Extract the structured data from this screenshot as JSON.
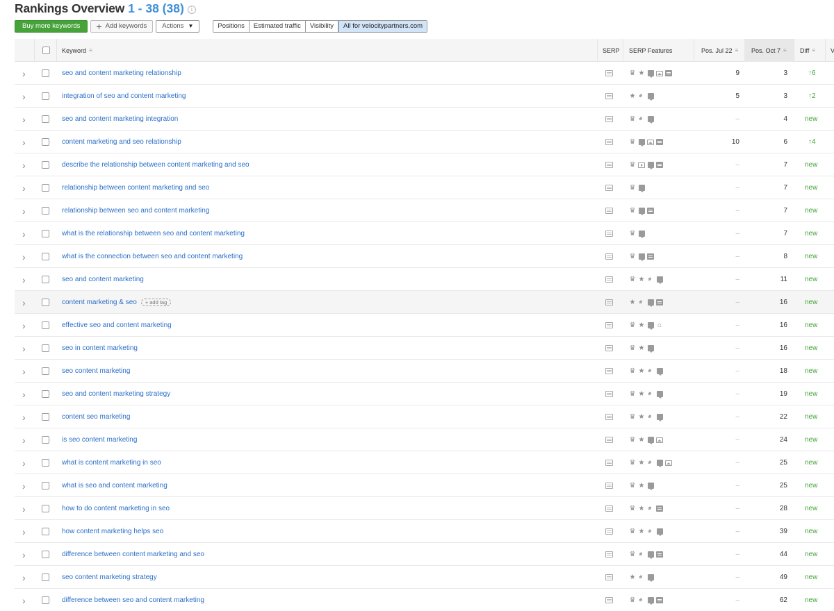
{
  "header": {
    "title": "Rankings Overview",
    "count": "1 - 38 (38)",
    "info_glyph": "i"
  },
  "toolbar": {
    "buy_label": "Buy more keywords",
    "add_label": "Add keywords",
    "actions_label": "Actions",
    "segments": [
      "Positions",
      "Estimated traffic",
      "Visibility",
      "All for velocitypartners.com"
    ],
    "active_segment": "All for velocitypartners.com"
  },
  "table": {
    "columns": {
      "keyword": "Keyword",
      "serp": "SERP",
      "serp_features": "SERP Features",
      "pos1": "Pos. Jul 22",
      "pos2": "Pos. Oct 7",
      "diff": "Diff",
      "volume_partial": "V"
    },
    "add_tag_label": "add tag",
    "rows": [
      {
        "keyword": "seo and content marketing relationship",
        "features": [
          "crown",
          "star",
          "box",
          "img",
          "news"
        ],
        "pos1": "9",
        "pos2": "3",
        "diff": "6",
        "diff_type": "up"
      },
      {
        "keyword": "integration of seo and content marketing",
        "features": [
          "star",
          "link",
          "box"
        ],
        "pos1": "5",
        "pos2": "3",
        "diff": "2",
        "diff_type": "up"
      },
      {
        "keyword": "seo and content marketing integration",
        "features": [
          "crown",
          "link",
          "box"
        ],
        "pos1": "–",
        "pos2": "4",
        "diff": "new",
        "diff_type": "new"
      },
      {
        "keyword": "content marketing and seo relationship",
        "features": [
          "crown",
          "box",
          "img",
          "news"
        ],
        "pos1": "10",
        "pos2": "6",
        "diff": "4",
        "diff_type": "up"
      },
      {
        "keyword": "describe the relationship between content marketing and seo",
        "features": [
          "crown",
          "video",
          "box",
          "news"
        ],
        "pos1": "–",
        "pos2": "7",
        "diff": "new",
        "diff_type": "new"
      },
      {
        "keyword": "relationship between content marketing and seo",
        "features": [
          "crown",
          "box"
        ],
        "pos1": "–",
        "pos2": "7",
        "diff": "new",
        "diff_type": "new"
      },
      {
        "keyword": "relationship between seo and content marketing",
        "features": [
          "crown",
          "box",
          "news"
        ],
        "pos1": "–",
        "pos2": "7",
        "diff": "new",
        "diff_type": "new"
      },
      {
        "keyword": "what is the relationship between seo and content marketing",
        "features": [
          "crown",
          "box"
        ],
        "pos1": "–",
        "pos2": "7",
        "diff": "new",
        "diff_type": "new"
      },
      {
        "keyword": "what is the connection between seo and content marketing",
        "features": [
          "crown",
          "box",
          "news"
        ],
        "pos1": "–",
        "pos2": "8",
        "diff": "new",
        "diff_type": "new"
      },
      {
        "keyword": "seo and content marketing",
        "features": [
          "crown",
          "star",
          "link",
          "box"
        ],
        "pos1": "–",
        "pos2": "11",
        "diff": "new",
        "diff_type": "new"
      },
      {
        "keyword": "content marketing & seo",
        "features": [
          "star",
          "link",
          "box",
          "news"
        ],
        "pos1": "–",
        "pos2": "16",
        "diff": "new",
        "diff_type": "new",
        "has_tag": true
      },
      {
        "keyword": "effective seo and content marketing",
        "features": [
          "crown",
          "star",
          "box",
          "cap"
        ],
        "pos1": "–",
        "pos2": "16",
        "diff": "new",
        "diff_type": "new"
      },
      {
        "keyword": "seo in content marketing",
        "features": [
          "crown",
          "star",
          "box"
        ],
        "pos1": "–",
        "pos2": "16",
        "diff": "new",
        "diff_type": "new"
      },
      {
        "keyword": "seo content marketing",
        "features": [
          "crown",
          "star",
          "link",
          "box"
        ],
        "pos1": "–",
        "pos2": "18",
        "diff": "new",
        "diff_type": "new"
      },
      {
        "keyword": "seo and content marketing strategy",
        "features": [
          "crown",
          "star",
          "link",
          "box"
        ],
        "pos1": "–",
        "pos2": "19",
        "diff": "new",
        "diff_type": "new"
      },
      {
        "keyword": "content seo marketing",
        "features": [
          "crown",
          "star",
          "link",
          "box"
        ],
        "pos1": "–",
        "pos2": "22",
        "diff": "new",
        "diff_type": "new"
      },
      {
        "keyword": "is seo content marketing",
        "features": [
          "crown",
          "star",
          "box",
          "img"
        ],
        "pos1": "–",
        "pos2": "24",
        "diff": "new",
        "diff_type": "new"
      },
      {
        "keyword": "what is content marketing in seo",
        "features": [
          "crown",
          "star",
          "link",
          "box",
          "img"
        ],
        "pos1": "–",
        "pos2": "25",
        "diff": "new",
        "diff_type": "new"
      },
      {
        "keyword": "what is seo and content marketing",
        "features": [
          "crown",
          "star",
          "box"
        ],
        "pos1": "–",
        "pos2": "25",
        "diff": "new",
        "diff_type": "new"
      },
      {
        "keyword": "how to do content marketing in seo",
        "features": [
          "crown",
          "star",
          "link",
          "news"
        ],
        "pos1": "–",
        "pos2": "28",
        "diff": "new",
        "diff_type": "new"
      },
      {
        "keyword": "how content marketing helps seo",
        "features": [
          "crown",
          "star",
          "link",
          "box"
        ],
        "pos1": "–",
        "pos2": "39",
        "diff": "new",
        "diff_type": "new"
      },
      {
        "keyword": "difference between content marketing and seo",
        "features": [
          "crown",
          "link",
          "box",
          "news"
        ],
        "pos1": "–",
        "pos2": "44",
        "diff": "new",
        "diff_type": "new"
      },
      {
        "keyword": "seo content marketing strategy",
        "features": [
          "star",
          "link",
          "box"
        ],
        "pos1": "–",
        "pos2": "49",
        "diff": "new",
        "diff_type": "new"
      },
      {
        "keyword": "difference between seo and content marketing",
        "features": [
          "crown",
          "link",
          "box",
          "news"
        ],
        "pos1": "–",
        "pos2": "62",
        "diff": "new",
        "diff_type": "new"
      }
    ]
  },
  "colors": {
    "accent": "#3d8fd8",
    "link": "#2b6fc7",
    "positive": "#45a33a",
    "buy_button": "#45a33a"
  }
}
